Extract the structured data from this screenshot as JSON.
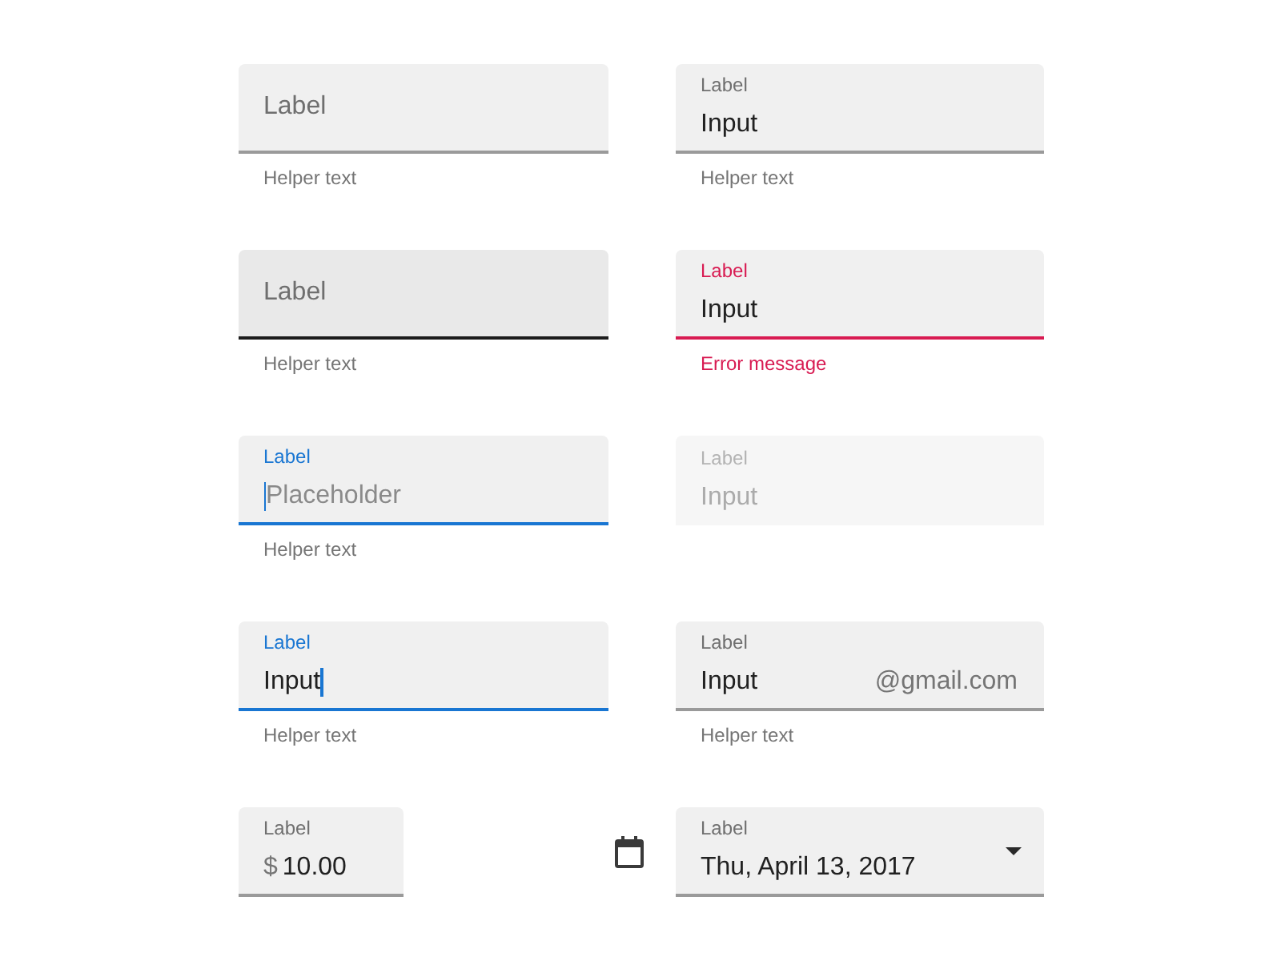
{
  "rows": [
    {
      "fields": [
        {
          "kind": "text",
          "label": "Label",
          "hovered": false,
          "focused": false,
          "error": false,
          "disabled": false,
          "helper": "Helper text"
        },
        {
          "kind": "text",
          "label": "Label",
          "value": "Input",
          "hovered": false,
          "focused": false,
          "error": false,
          "disabled": false,
          "helper": "Helper text"
        }
      ]
    },
    {
      "fields": [
        {
          "kind": "text",
          "label": "Label",
          "hovered": true,
          "focused": false,
          "error": false,
          "disabled": false,
          "helper": "Helper text"
        },
        {
          "kind": "text",
          "label": "Label",
          "value": "Input",
          "hovered": false,
          "focused": false,
          "error": true,
          "disabled": false,
          "helper": "Error message"
        }
      ]
    },
    {
      "fields": [
        {
          "kind": "text",
          "label": "Label",
          "placeholder": "Placeholder",
          "hovered": false,
          "focused": true,
          "error": false,
          "disabled": false,
          "helper": "Helper text"
        },
        {
          "kind": "text",
          "label": "Label",
          "value": "Input",
          "hovered": false,
          "focused": false,
          "error": false,
          "disabled": true
        }
      ]
    },
    {
      "fields": [
        {
          "kind": "text",
          "label": "Label",
          "value": "Input",
          "hovered": false,
          "focused": true,
          "error": false,
          "disabled": false,
          "helper": "Helper text"
        },
        {
          "kind": "text",
          "label": "Label",
          "value": "Input",
          "suffix": "@gmail.com",
          "hovered": false,
          "focused": false,
          "error": false,
          "disabled": false,
          "helper": "Helper text"
        }
      ]
    },
    {
      "fields": [
        {
          "kind": "currency",
          "label": "Label",
          "prefix": "$",
          "value": "10.00",
          "hovered": false,
          "focused": false,
          "error": false,
          "disabled": false
        },
        {
          "kind": "date",
          "label": "Label",
          "value": "Thu, April 13, 2017",
          "hovered": false,
          "focused": false,
          "error": false,
          "disabled": false
        }
      ]
    }
  ]
}
